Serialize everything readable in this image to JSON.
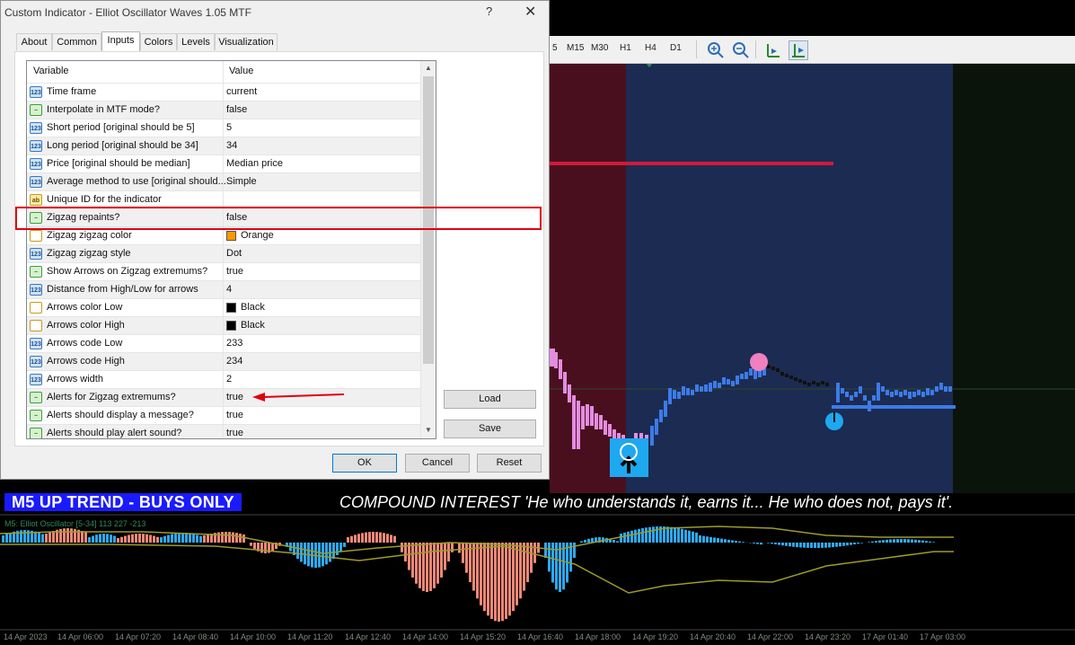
{
  "dialog": {
    "title": "Custom Indicator - Elliot Oscillator Waves 1.05 MTF",
    "help_label": "?",
    "close_label": "✕",
    "tabs": [
      {
        "label": "About",
        "active": false
      },
      {
        "label": "Common",
        "active": false
      },
      {
        "label": "Inputs",
        "active": true
      },
      {
        "label": "Colors",
        "active": false
      },
      {
        "label": "Levels",
        "active": false
      },
      {
        "label": "Visualization",
        "active": false
      }
    ],
    "grid": {
      "col_variable": "Variable",
      "col_value": "Value",
      "rows": [
        {
          "type": "num",
          "icon": "123",
          "variable": "Time frame",
          "value": "current"
        },
        {
          "type": "bool",
          "icon": "~",
          "variable": "Interpolate in MTF mode?",
          "value": "false"
        },
        {
          "type": "num",
          "icon": "123",
          "variable": "Short period [original should be 5]",
          "value": "5"
        },
        {
          "type": "num",
          "icon": "123",
          "variable": "Long period [original should be 34]",
          "value": "34"
        },
        {
          "type": "num",
          "icon": "123",
          "variable": "Price [original should be median]",
          "value": "Median price"
        },
        {
          "type": "num",
          "icon": "123",
          "variable": "Average method to use [original should...",
          "value": "Simple"
        },
        {
          "type": "str",
          "icon": "ab",
          "variable": "Unique ID for the indicator",
          "value": ""
        },
        {
          "type": "bool",
          "icon": "~",
          "variable": "Zigzag repaints?",
          "value": "false"
        },
        {
          "type": "col",
          "icon": "",
          "variable": "Zigzag zigzag color",
          "value": "Orange",
          "swatch": "#ff9900"
        },
        {
          "type": "num",
          "icon": "123",
          "variable": "Zigzag zigzag style",
          "value": "Dot"
        },
        {
          "type": "bool",
          "icon": "~",
          "variable": "Show Arrows on Zigzag extremums?",
          "value": "true"
        },
        {
          "type": "num",
          "icon": "123",
          "variable": "Distance from High/Low for arrows",
          "value": "4"
        },
        {
          "type": "col",
          "icon": "",
          "variable": "Arrows color Low",
          "value": "Black",
          "swatch": "#000000"
        },
        {
          "type": "col",
          "icon": "",
          "variable": "Arrows color High",
          "value": "Black",
          "swatch": "#000000"
        },
        {
          "type": "num",
          "icon": "123",
          "variable": "Arrows code Low",
          "value": "233"
        },
        {
          "type": "num",
          "icon": "123",
          "variable": "Arrows code High",
          "value": "234"
        },
        {
          "type": "num",
          "icon": "123",
          "variable": "Arrows width",
          "value": "2"
        },
        {
          "type": "bool",
          "icon": "~",
          "variable": "Alerts for Zigzag extremums?",
          "value": "true"
        },
        {
          "type": "bool",
          "icon": "~",
          "variable": "Alerts should display a message?",
          "value": "true"
        },
        {
          "type": "bool",
          "icon": "~",
          "variable": "Alerts should play alert sound?",
          "value": "true"
        }
      ]
    },
    "buttons": {
      "load": "Load",
      "save": "Save",
      "ok": "OK",
      "cancel": "Cancel",
      "reset": "Reset"
    }
  },
  "toolbar": {
    "timeframes": [
      "5",
      "M15",
      "M30",
      "H1",
      "H4",
      "D1"
    ]
  },
  "chart": {
    "caption_left": "M5 UP TREND - BUYS ONLY",
    "caption_right": "COMPOUND INTEREST  'He who understands it, earns it... He who does not, pays it'.",
    "oscillator_label": "M5: Elliot Oscillator [5-34]  113 227 -213",
    "time_labels": [
      "14 Apr 2023",
      "14 Apr 06:00",
      "14 Apr 07:20",
      "14 Apr 08:40",
      "14 Apr 10:00",
      "14 Apr 11:20",
      "14 Apr 12:40",
      "14 Apr 14:00",
      "14 Apr 15:20",
      "14 Apr 16:40",
      "14 Apr 18:00",
      "14 Apr 19:20",
      "14 Apr 20:40",
      "14 Apr 22:00",
      "14 Apr 23:20",
      "17 Apr 01:40",
      "17 Apr 03:00"
    ],
    "colors": {
      "background": "#000000",
      "bull_zone": "#1c2b52",
      "bear_zone": "#4a0f1e",
      "candle_up": "#3d7be8",
      "candle_down": "#e48ce0",
      "hist_up": "#2ea8f0",
      "hist_down": "#f08878",
      "signal_line": "#9c9c2a",
      "resistance": "#d01a3a"
    }
  }
}
